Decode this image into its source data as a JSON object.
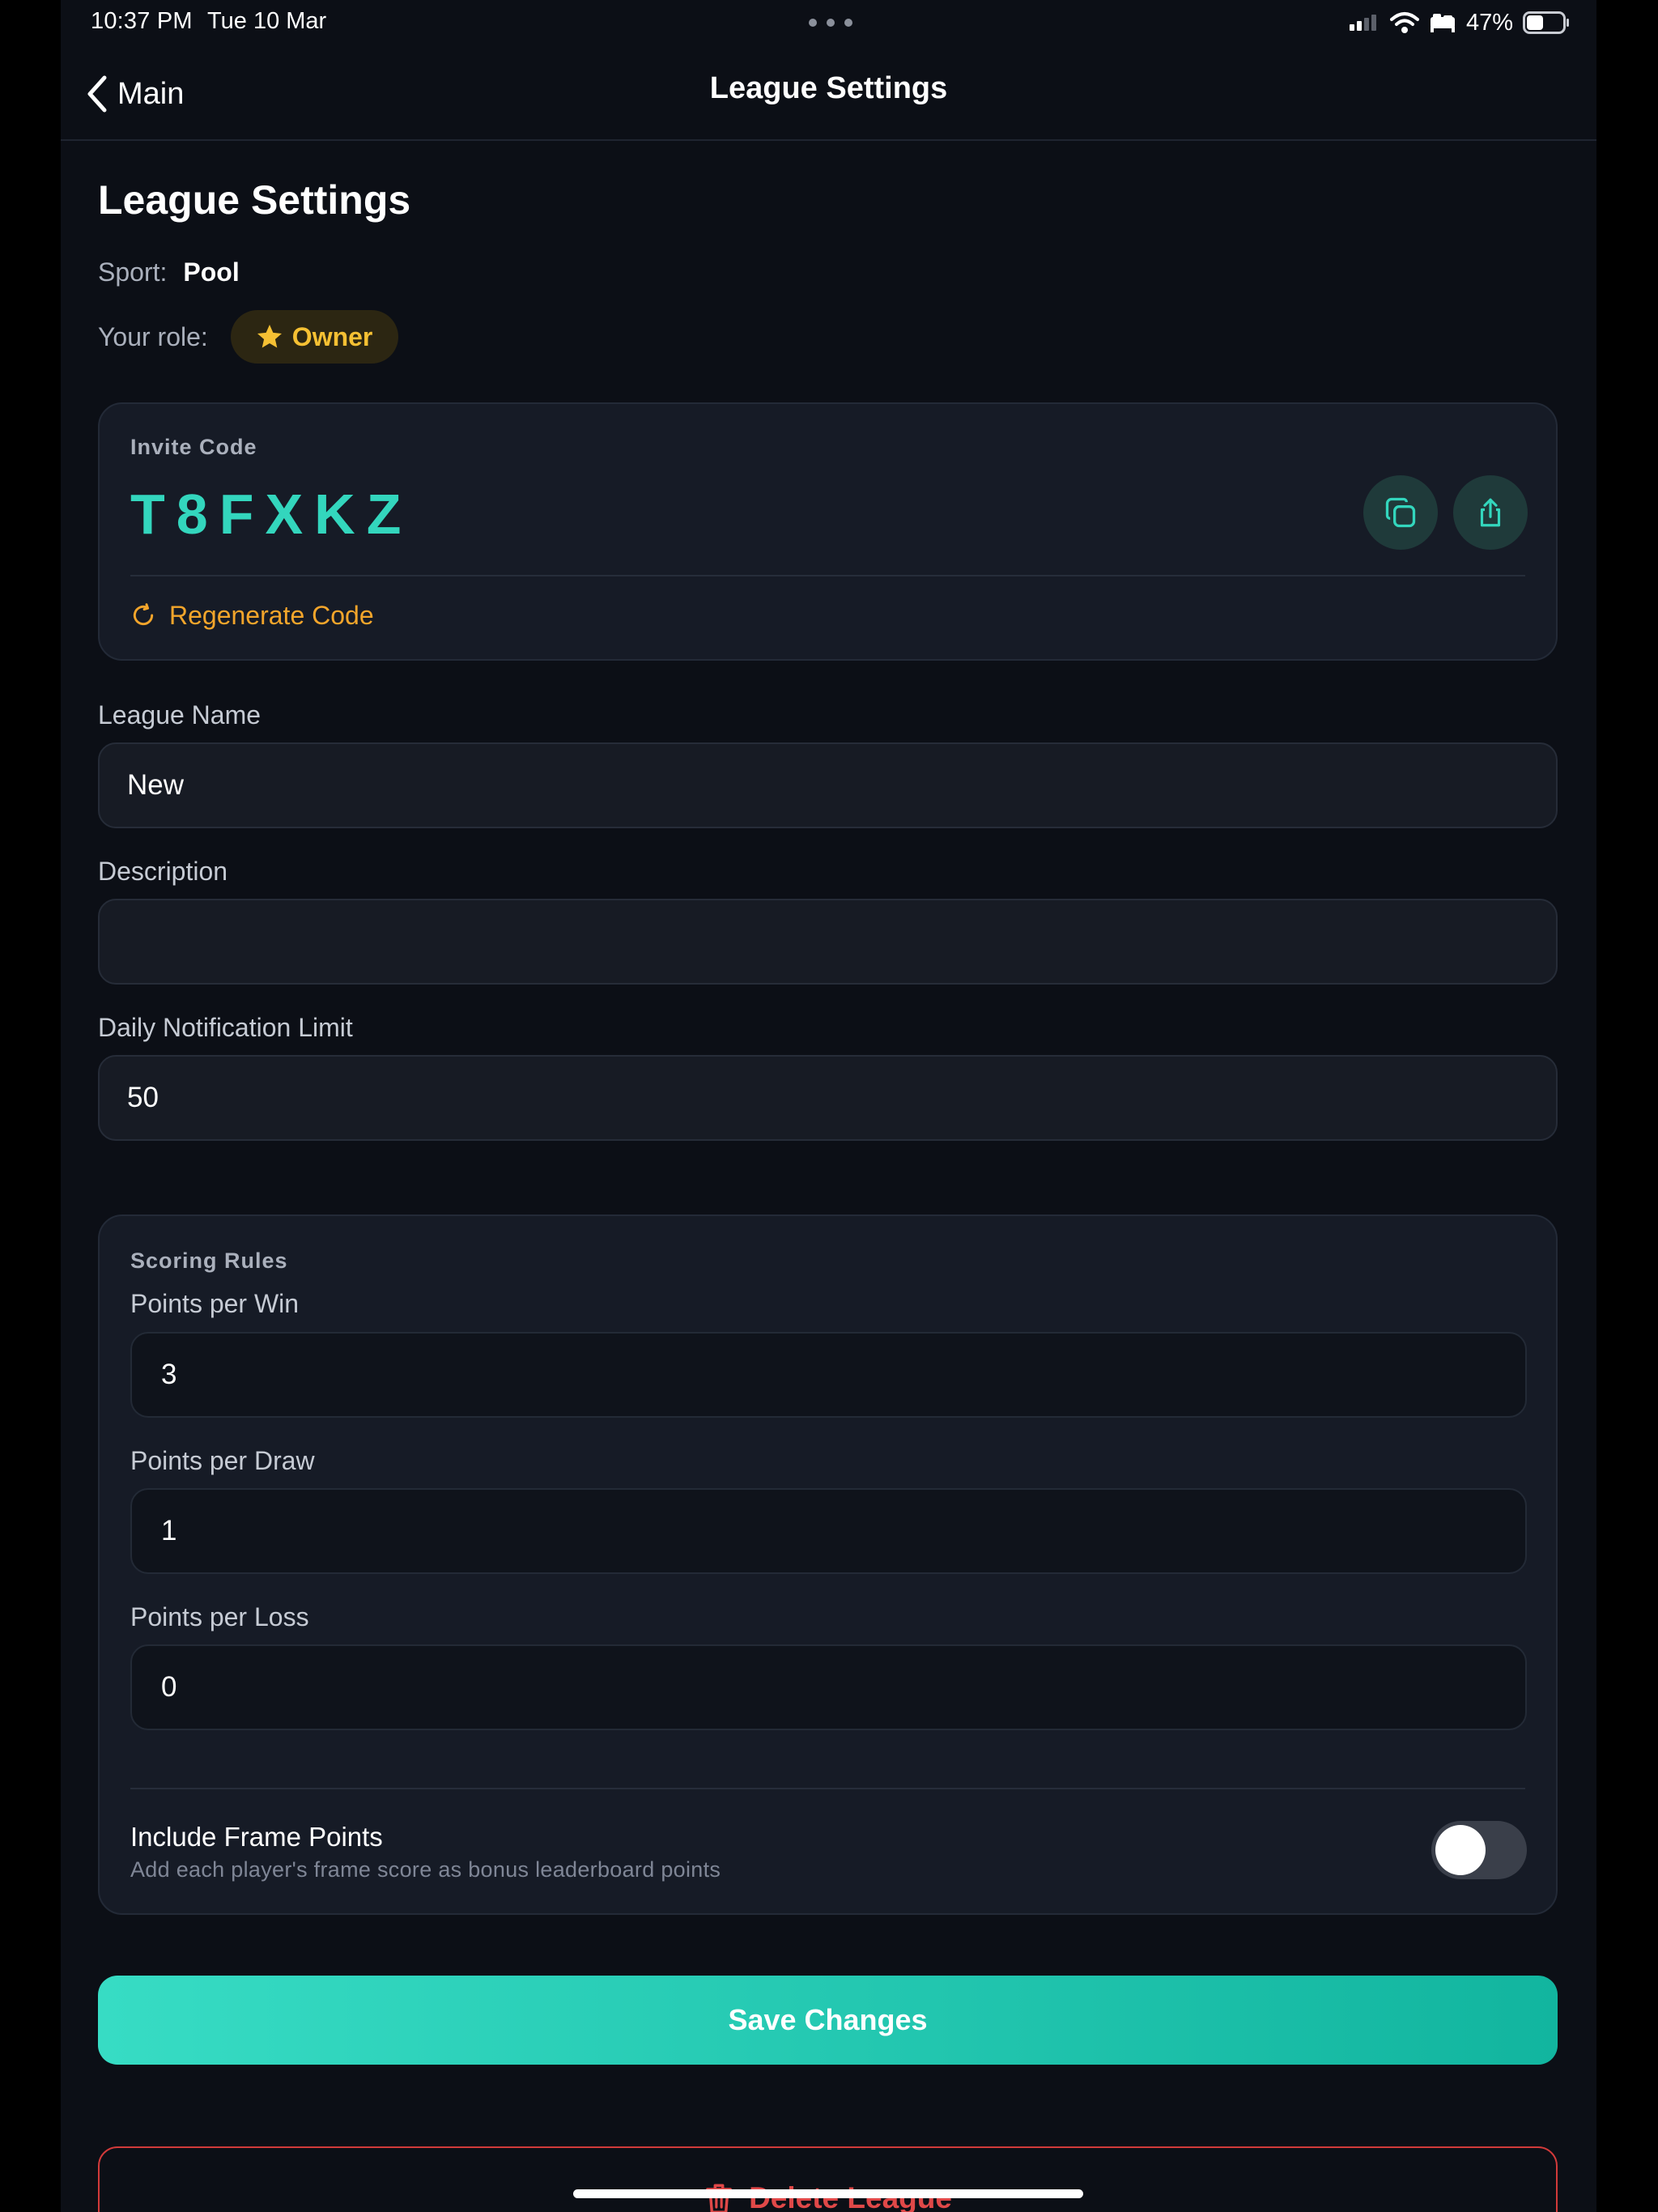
{
  "status_bar": {
    "time": "10:37 PM",
    "date": "Tue 10 Mar",
    "battery_percent": "47%",
    "battery_level": 0.47,
    "icons": [
      "signal-icon",
      "wifi-icon",
      "sleep-focus-icon",
      "battery-icon"
    ]
  },
  "nav": {
    "back_label": "Main",
    "title": "League Settings"
  },
  "page": {
    "title": "League Settings",
    "sport_label": "Sport:",
    "sport_value": "Pool",
    "role_label": "Your role:",
    "role_value": "Owner"
  },
  "invite": {
    "caption": "Invite Code",
    "code": "T8FXKZ",
    "regenerate_label": "Regenerate Code"
  },
  "fields": {
    "league_name": {
      "label": "League Name",
      "value": "New"
    },
    "description": {
      "label": "Description",
      "value": ""
    },
    "notification_limit": {
      "label": "Daily Notification Limit",
      "value": "50"
    }
  },
  "scoring": {
    "caption": "Scoring Rules",
    "points_per_win": {
      "label": "Points per Win",
      "value": "3"
    },
    "points_per_draw": {
      "label": "Points per Draw",
      "value": "1"
    },
    "points_per_loss": {
      "label": "Points per Loss",
      "value": "0"
    },
    "frame_points": {
      "title": "Include Frame Points",
      "description": "Add each player's frame score as bonus leaderboard points",
      "enabled": false
    }
  },
  "actions": {
    "save_label": "Save Changes",
    "delete_label": "Delete League"
  },
  "colors": {
    "background": "#0c0f16",
    "accent": "#33d6bd",
    "warning": "#f3a52b",
    "owner_badge": "#f5c033",
    "danger": "#e04848"
  }
}
